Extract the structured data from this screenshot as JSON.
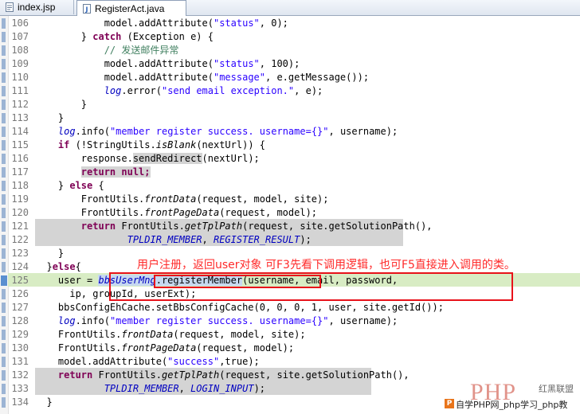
{
  "tabs": [
    {
      "label": "index.jsp"
    },
    {
      "label": "RegisterAct.java"
    }
  ],
  "annotation": "用户注册，返回user对象 可F3先看下调用逻辑，也可F5直接进入调用的类。",
  "watermark": {
    "logo": "PHP",
    "tag": "红黑联盟",
    "text": "自学PHP网_php学习_php教"
  },
  "lines": [
    {
      "n": "106",
      "tokens": [
        {
          "t": "            model.addAttribute("
        },
        {
          "t": "\"status\"",
          "c": "st"
        },
        {
          "t": ", 0);"
        }
      ]
    },
    {
      "n": "107",
      "tokens": [
        {
          "t": "        } "
        },
        {
          "t": "catch",
          "c": "kw"
        },
        {
          "t": " (Exception e) {"
        }
      ]
    },
    {
      "n": "108",
      "tokens": [
        {
          "t": "            "
        },
        {
          "t": "// 发送邮件异常",
          "c": "cm"
        }
      ]
    },
    {
      "n": "109",
      "tokens": [
        {
          "t": "            model.addAttribute("
        },
        {
          "t": "\"status\"",
          "c": "st"
        },
        {
          "t": ", 100);"
        }
      ]
    },
    {
      "n": "110",
      "tokens": [
        {
          "t": "            model.addAttribute("
        },
        {
          "t": "\"message\"",
          "c": "st"
        },
        {
          "t": ", e.getMessage());"
        }
      ]
    },
    {
      "n": "111",
      "tokens": [
        {
          "t": "            "
        },
        {
          "t": "log",
          "c": "fld"
        },
        {
          "t": ".error("
        },
        {
          "t": "\"send email exception.\"",
          "c": "st"
        },
        {
          "t": ", e);"
        }
      ]
    },
    {
      "n": "112",
      "tokens": [
        {
          "t": "        }"
        }
      ]
    },
    {
      "n": "113",
      "tokens": [
        {
          "t": "    }"
        }
      ]
    },
    {
      "n": "114",
      "tokens": [
        {
          "t": "    "
        },
        {
          "t": "log",
          "c": "fld"
        },
        {
          "t": ".info("
        },
        {
          "t": "\"member register success. username={}\"",
          "c": "st"
        },
        {
          "t": ", username);"
        }
      ]
    },
    {
      "n": "115",
      "tokens": [
        {
          "t": "    "
        },
        {
          "t": "if",
          "c": "kw"
        },
        {
          "t": " (!StringUtils."
        },
        {
          "t": "isBlank",
          "c": "it"
        },
        {
          "t": "(nextUrl)) {"
        }
      ]
    },
    {
      "n": "116",
      "tokens": [
        {
          "t": "        response."
        },
        {
          "t": "sendRedirect",
          "c": "hl-grey"
        },
        {
          "t": "(nextUrl);"
        }
      ]
    },
    {
      "n": "117",
      "tokens": [
        {
          "t": "        "
        },
        {
          "t": "return null;",
          "c": "kw hl-grey"
        }
      ]
    },
    {
      "n": "118",
      "tokens": [
        {
          "t": "    } "
        },
        {
          "t": "else",
          "c": "kw"
        },
        {
          "t": " {"
        }
      ]
    },
    {
      "n": "119",
      "tokens": [
        {
          "t": "        FrontUtils."
        },
        {
          "t": "frontData",
          "c": "it"
        },
        {
          "t": "(request, model, site);"
        }
      ]
    },
    {
      "n": "120",
      "tokens": [
        {
          "t": "        FrontUtils."
        },
        {
          "t": "frontPageData",
          "c": "it"
        },
        {
          "t": "(request, model);"
        }
      ]
    },
    {
      "n": "121",
      "tokens": [
        {
          "t": "        "
        },
        {
          "t": "return",
          "c": "kw"
        },
        {
          "t": " FrontUtils."
        },
        {
          "t": "getTplPath",
          "c": "it"
        },
        {
          "t": "(request, site.getSolutionPath(),"
        }
      ]
    },
    {
      "n": "122",
      "tokens": [
        {
          "t": "                "
        },
        {
          "t": "TPLDIR_MEMBER",
          "c": "fld"
        },
        {
          "t": ", "
        },
        {
          "t": "REGISTER_RESULT",
          "c": "fld"
        },
        {
          "t": ");"
        }
      ]
    },
    {
      "n": "123",
      "tokens": [
        {
          "t": "    }"
        }
      ]
    },
    {
      "n": "124",
      "tokens": [
        {
          "t": "  }"
        },
        {
          "t": "else",
          "c": "kw"
        },
        {
          "t": "{"
        }
      ]
    },
    {
      "n": "125",
      "tokens": [
        {
          "t": "    user = "
        },
        {
          "t": "bbsUserMng",
          "c": "fld hl-blue"
        },
        {
          "t": ".registerMember",
          "c": "hl-blue"
        },
        {
          "t": "(username, email, password,"
        }
      ]
    },
    {
      "n": "126",
      "tokens": [
        {
          "t": "      ip, groupId, userExt);"
        }
      ]
    },
    {
      "n": "127",
      "tokens": [
        {
          "t": "    bbsConfigEhCache.setBbsConfigCache(0, 0, 0, 1, user, site.getId());"
        }
      ]
    },
    {
      "n": "128",
      "tokens": [
        {
          "t": "    "
        },
        {
          "t": "log",
          "c": "fld"
        },
        {
          "t": ".info("
        },
        {
          "t": "\"member register success. username={}\"",
          "c": "st"
        },
        {
          "t": ", username);"
        }
      ]
    },
    {
      "n": "129",
      "tokens": [
        {
          "t": "    FrontUtils."
        },
        {
          "t": "frontData",
          "c": "it"
        },
        {
          "t": "(request, model, site);"
        }
      ]
    },
    {
      "n": "130",
      "tokens": [
        {
          "t": "    FrontUtils."
        },
        {
          "t": "frontPageData",
          "c": "it"
        },
        {
          "t": "(request, model);"
        }
      ]
    },
    {
      "n": "131",
      "tokens": [
        {
          "t": "    model.addAttribute("
        },
        {
          "t": "\"success\"",
          "c": "st"
        },
        {
          "t": ",true);"
        }
      ]
    },
    {
      "n": "132",
      "tokens": [
        {
          "t": "    "
        },
        {
          "t": "return",
          "c": "kw"
        },
        {
          "t": " FrontUtils."
        },
        {
          "t": "getTplPath",
          "c": "it"
        },
        {
          "t": "(request, site.getSolutionPath(),"
        }
      ]
    },
    {
      "n": "133",
      "tokens": [
        {
          "t": "            "
        },
        {
          "t": "TPLDIR_MEMBER",
          "c": "fld"
        },
        {
          "t": ", "
        },
        {
          "t": "LOGIN_INPUT",
          "c": "fld"
        },
        {
          "t": ");"
        }
      ]
    },
    {
      "n": "134",
      "tokens": [
        {
          "t": "  }"
        }
      ]
    }
  ]
}
